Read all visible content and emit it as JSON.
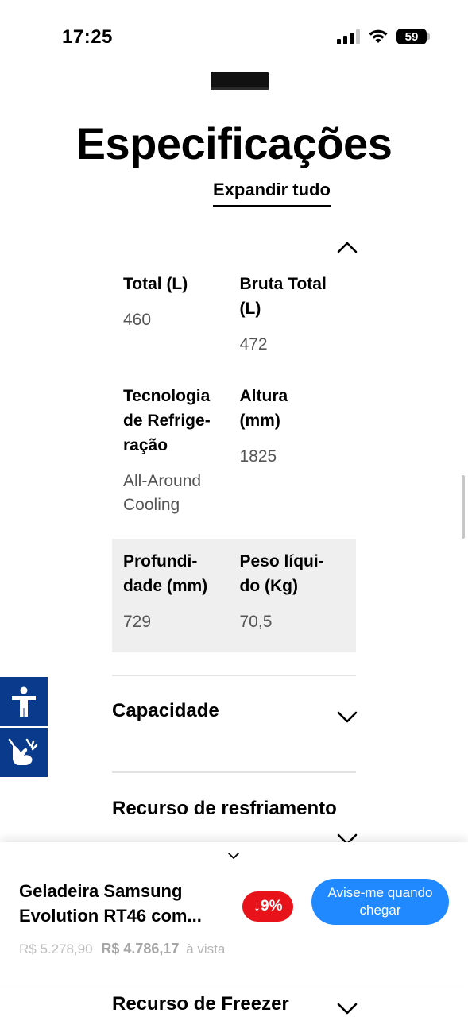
{
  "status_bar": {
    "time": "17:25",
    "battery": "59"
  },
  "page": {
    "title": "Especificações",
    "expand_all": "Expandir tudo"
  },
  "specs": [
    {
      "label": "Total (L)",
      "value": "460"
    },
    {
      "label": "Bruta Total (L)",
      "value": "472"
    },
    {
      "label": "Tecnologia de Refrige-ração",
      "value": "All-Around Cooling"
    },
    {
      "label": "Altura (mm)",
      "value": "1825"
    },
    {
      "label": "Profundi-dade (mm)",
      "value": "729"
    },
    {
      "label": "Peso líqui-do (Kg)",
      "value": "70,5"
    }
  ],
  "sections": {
    "capacidade": "Capacidade",
    "resfriamento": "Recurso de resfriamento",
    "freezer": "Recurso de Freezer"
  },
  "bottom_sheet": {
    "product_name": "Geladeira Samsung Evolution RT46 com...",
    "discount": "↓9%",
    "notify_button": "Avise-me quando chegar",
    "old_price": "R$ 5.278,90",
    "new_price": "R$ 4.786,17",
    "price_suffix": "à vista"
  },
  "accessibility": {
    "buttons": [
      "accessibility-icon",
      "sign-language-icon"
    ]
  }
}
